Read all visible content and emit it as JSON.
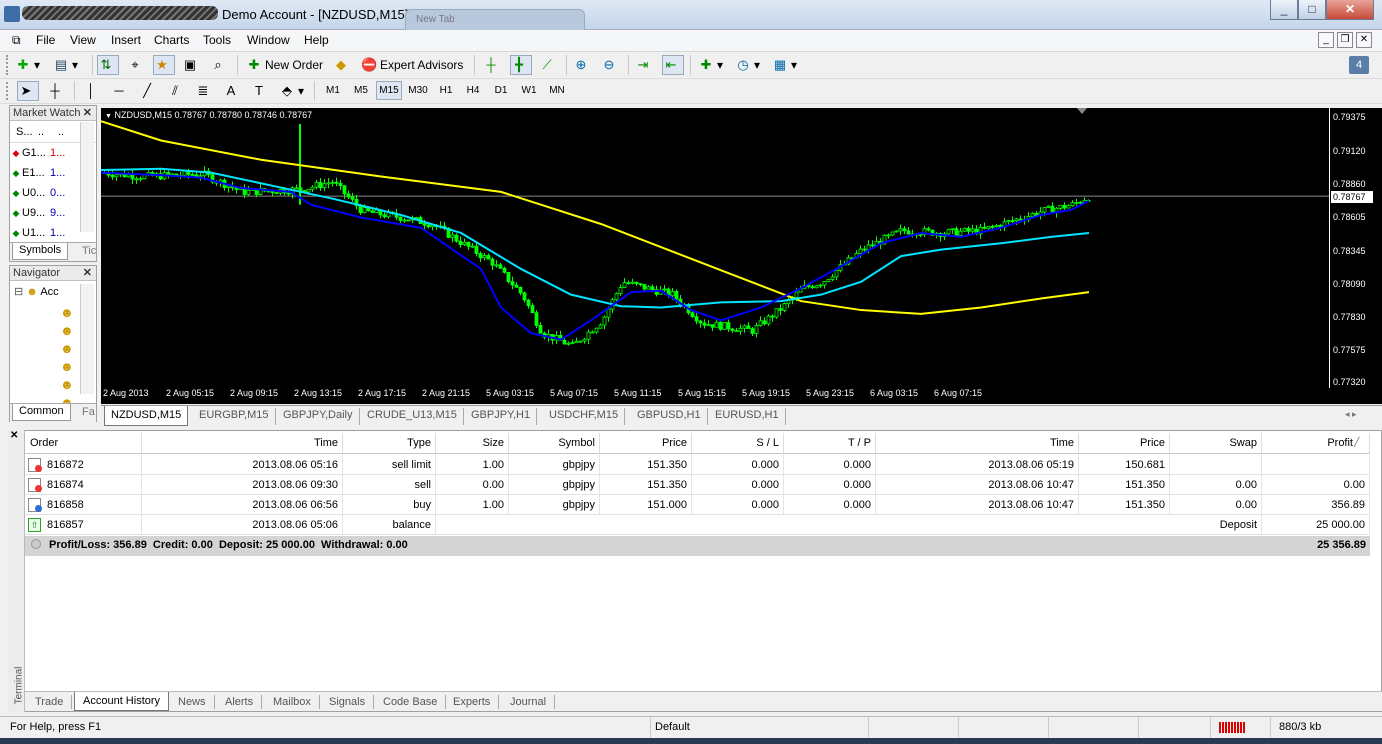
{
  "window": {
    "title": "Demo Account - [NZDUSD,M15]",
    "ghost_tab": "New Tab"
  },
  "menu": [
    "File",
    "View",
    "Insert",
    "Charts",
    "Tools",
    "Window",
    "Help"
  ],
  "toolbar": {
    "new_order": "New Order",
    "expert_advisors": "Expert Advisors"
  },
  "drawbar": {
    "text_tool": "A",
    "timeframes": [
      "M1",
      "M5",
      "M15",
      "M30",
      "H1",
      "H4",
      "D1",
      "W1",
      "MN"
    ],
    "active_tf": "M15"
  },
  "market_watch": {
    "title": "Market Watch",
    "headers": [
      "S...",
      "..",
      ".."
    ],
    "rows": [
      {
        "sym": "G1...",
        "val": "1...",
        "dir": "down"
      },
      {
        "sym": "E1...",
        "val": "1...",
        "dir": "up"
      },
      {
        "sym": "U0...",
        "val": "0...",
        "dir": "up"
      },
      {
        "sym": "U9...",
        "val": "9...",
        "dir": "up"
      },
      {
        "sym": "U1...",
        "val": "1...",
        "dir": "up"
      }
    ],
    "tabs": [
      "Symbols",
      "Tic"
    ]
  },
  "navigator": {
    "title": "Navigator",
    "root": "Acc",
    "tabs": [
      "Common",
      "Fa"
    ]
  },
  "chart": {
    "header": "NZDUSD,M15  0.78767 0.78780 0.78746 0.78767",
    "current_price": "0.78767",
    "price_ticks": [
      "0.79375",
      "0.79120",
      "0.78860",
      "0.78605",
      "0.78345",
      "0.78090",
      "0.77830",
      "0.77575",
      "0.77320"
    ],
    "time_ticks": [
      "2 Aug 2013",
      "2 Aug 05:15",
      "2 Aug 09:15",
      "2 Aug 13:15",
      "2 Aug 17:15",
      "2 Aug 21:15",
      "5 Aug 03:15",
      "5 Aug 07:15",
      "5 Aug 11:15",
      "5 Aug 15:15",
      "5 Aug 19:15",
      "5 Aug 23:15",
      "6 Aug 03:15",
      "6 Aug 07:15"
    ],
    "colors": {
      "candles": "#00ff00",
      "ma_fast": "#0000ff",
      "ma_mid": "#00e5ff",
      "ma_slow": "#ffff00"
    }
  },
  "chart_tabs": [
    "NZDUSD,M15",
    "EURGBP,M15",
    "GBPJPY,Daily",
    "CRUDE_U13,M15",
    "GBPJPY,H1",
    "USDCHF,M15",
    "GBPUSD,H1",
    "EURUSD,H1"
  ],
  "terminal": {
    "side_label": "Terminal",
    "headers": [
      "Order",
      "Time",
      "Type",
      "Size",
      "Symbol",
      "Price",
      "S / L",
      "T / P",
      "Time",
      "Price",
      "Swap",
      "Profit"
    ],
    "rows": [
      {
        "order": "816872",
        "time": "2013.08.06 05:16",
        "type": "sell limit",
        "size": "1.00",
        "symbol": "gbpjpy",
        "price": "151.350",
        "sl": "0.000",
        "tp": "0.000",
        "ctime": "2013.08.06 05:19",
        "cprice": "150.681",
        "swap": "",
        "profit": ""
      },
      {
        "order": "816874",
        "time": "2013.08.06 09:30",
        "type": "sell",
        "size": "0.00",
        "symbol": "gbpjpy",
        "price": "151.350",
        "sl": "0.000",
        "tp": "0.000",
        "ctime": "2013.08.06 10:47",
        "cprice": "151.350",
        "swap": "0.00",
        "profit": "0.00"
      },
      {
        "order": "816858",
        "time": "2013.08.06 06:56",
        "type": "buy",
        "size": "1.00",
        "symbol": "gbpjpy",
        "price": "151.000",
        "sl": "0.000",
        "tp": "0.000",
        "ctime": "2013.08.06 10:47",
        "cprice": "151.350",
        "swap": "0.00",
        "profit": "356.89"
      }
    ],
    "balance": {
      "order": "816857",
      "time": "2013.08.06 05:06",
      "type": "balance",
      "note": "Deposit",
      "amount": "25 000.00"
    },
    "summary": "Profit/Loss: 356.89  Credit: 0.00  Deposit: 25 000.00  Withdrawal: 0.00",
    "summary_total": "25 356.89",
    "tabs": [
      "Trade",
      "Account History",
      "News",
      "Alerts",
      "Mailbox",
      "Signals",
      "Code Base",
      "Experts",
      "Journal"
    ],
    "active_tab": "Account History"
  },
  "status": {
    "help": "For Help, press F1",
    "profile": "Default",
    "traffic": "880/3 kb"
  }
}
